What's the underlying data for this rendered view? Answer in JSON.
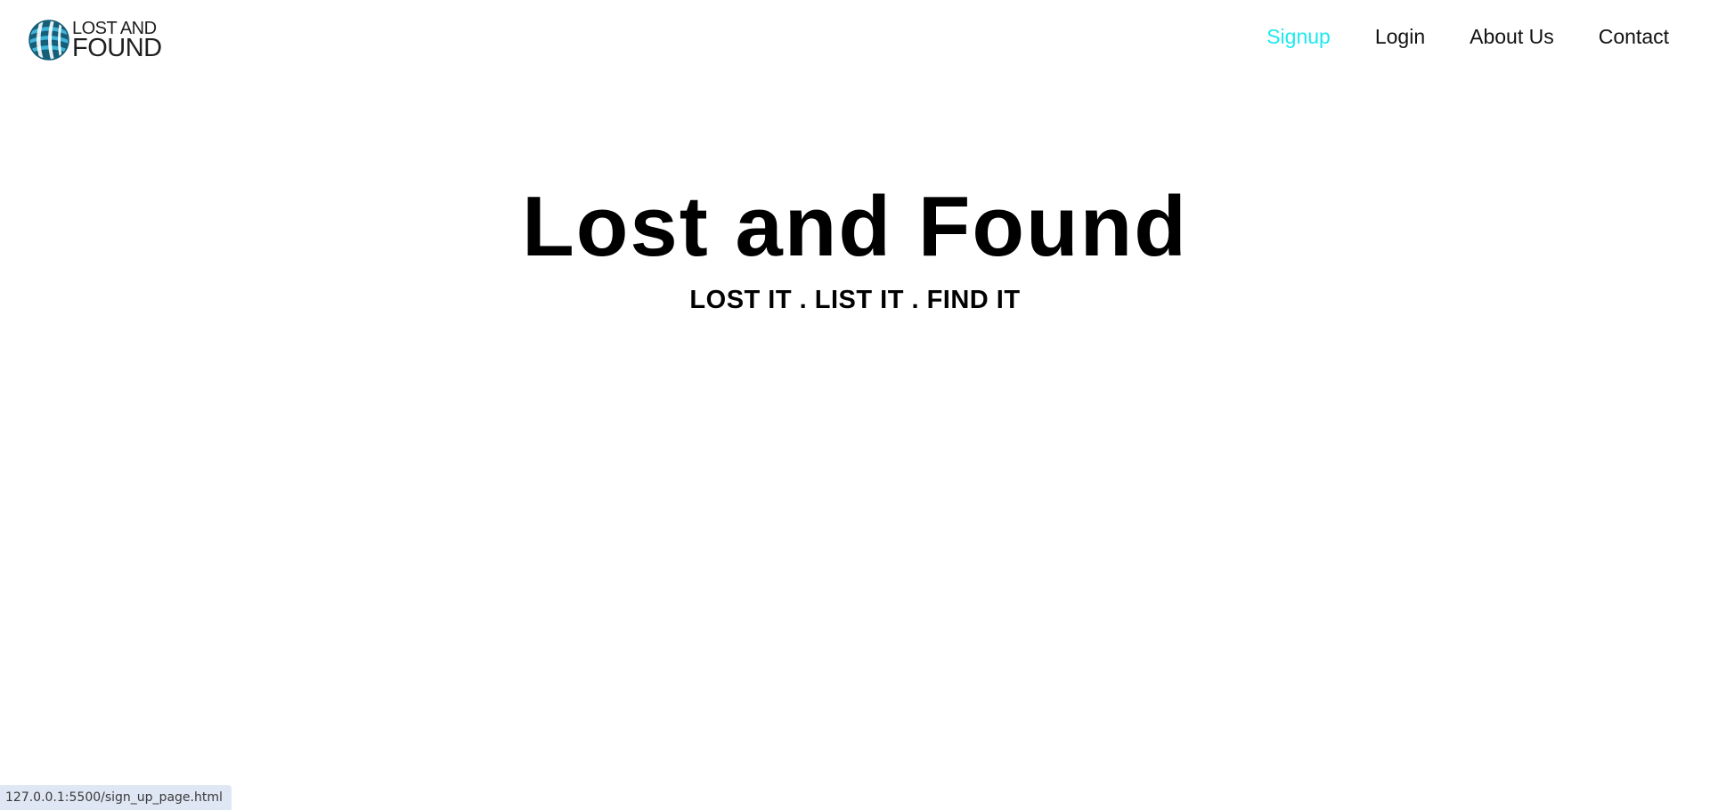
{
  "logo": {
    "line1": "LOST AND",
    "line2": "FOUND",
    "icon": "globe-icon",
    "colors": {
      "dark": "#145e78",
      "light": "#3fb3d8"
    }
  },
  "nav": {
    "items": [
      {
        "label": "Signup",
        "active": true
      },
      {
        "label": "Login",
        "active": false
      },
      {
        "label": "About Us",
        "active": false
      },
      {
        "label": "Contact",
        "active": false
      }
    ],
    "active_color": "#1ee8f0",
    "text_color": "#111111"
  },
  "hero": {
    "title": "Lost and Found",
    "tagline": "LOST IT . LIST IT . FIND IT"
  },
  "status_bar": {
    "url": "127.0.0.1:5500/sign_up_page.html"
  }
}
